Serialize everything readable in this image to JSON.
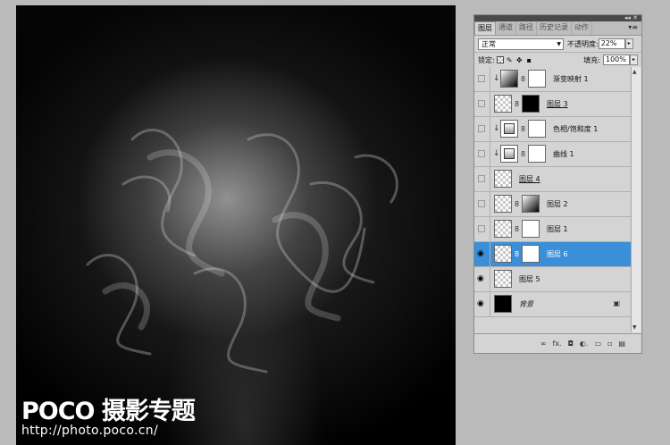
{
  "watermark": {
    "logo": "POCO 摄影专题",
    "url": "http://photo.poco.cn/"
  },
  "panel": {
    "tabs": [
      {
        "label": "图层",
        "active": true
      },
      {
        "label": "通道",
        "active": false
      },
      {
        "label": "路径",
        "active": false
      },
      {
        "label": "历史记录",
        "active": false
      },
      {
        "label": "动作",
        "active": false
      }
    ],
    "blend_mode": "正常",
    "opacity_label": "不透明度:",
    "opacity_value": "22%",
    "lock_label": "锁定:",
    "fill_label": "填充:",
    "fill_value": "100%",
    "layers": [
      {
        "name": "渐变映射 1",
        "visible": false,
        "clipped": true,
        "thumb": "grad",
        "mask": "white",
        "style": ""
      },
      {
        "name": "图层 3",
        "visible": false,
        "clipped": false,
        "thumb": "checker",
        "mask": "black",
        "style": "under"
      },
      {
        "name": "色相/饱和度 1",
        "visible": false,
        "clipped": true,
        "thumb": "adjust",
        "mask": "white",
        "style": ""
      },
      {
        "name": "曲线 1",
        "visible": false,
        "clipped": true,
        "thumb": "adjust",
        "mask": "white",
        "style": ""
      },
      {
        "name": "图层 4",
        "visible": false,
        "clipped": false,
        "thumb": "checker",
        "mask": "",
        "style": "under"
      },
      {
        "name": "图层 2",
        "visible": false,
        "clipped": false,
        "thumb": "checker",
        "mask": "grad",
        "style": ""
      },
      {
        "name": "图层 1",
        "visible": false,
        "clipped": false,
        "thumb": "checker",
        "mask": "white",
        "style": ""
      },
      {
        "name": "图层 6",
        "visible": true,
        "clipped": false,
        "thumb": "checker",
        "mask": "white",
        "style": "",
        "selected": true
      },
      {
        "name": "图层 5",
        "visible": true,
        "clipped": false,
        "thumb": "checker",
        "mask": "",
        "style": ""
      },
      {
        "name": "背景",
        "visible": true,
        "clipped": false,
        "thumb": "black",
        "mask": "",
        "style": "ital",
        "locked": true
      }
    ],
    "bottom_icons": [
      "link-icon",
      "fx-icon",
      "mask-icon",
      "adjustment-icon",
      "folder-icon",
      "new-layer-icon",
      "trash-icon"
    ],
    "bottom_glyphs": [
      "∞",
      "fx.",
      "◘",
      "◐.",
      "▭",
      "▫",
      "▤"
    ]
  }
}
